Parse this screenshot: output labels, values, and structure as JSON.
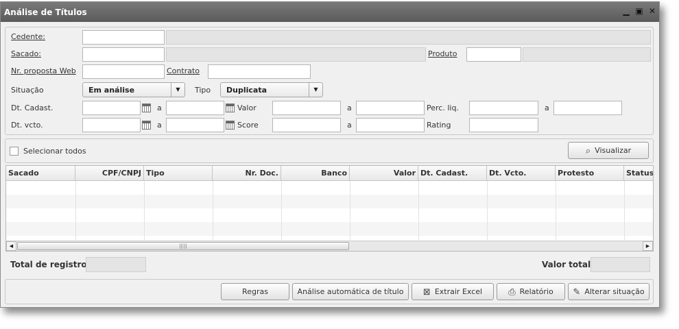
{
  "window": {
    "title": "Análise de Títulos"
  },
  "filters": {
    "cedente_label": "Cedente:",
    "sacado_label": "Sacado:",
    "produto_label": "Produto",
    "proposta_label": "Nr. proposta Web",
    "contrato_label": "Contrato",
    "situacao_label": "Situação",
    "situacao_value": "Em análise",
    "tipo_label": "Tipo",
    "tipo_value": "Duplicata",
    "dt_cadast_label": "Dt. Cadast.",
    "dt_vcto_label": "Dt. vcto.",
    "a_label": "a",
    "valor_label": "Valor",
    "score_label": "Score",
    "perc_label": "Perc. liq.",
    "rating_label": "Rating"
  },
  "toolbar": {
    "select_all_label": "Selecionar todos",
    "visualizar_label": "Visualizar"
  },
  "table": {
    "columns": [
      "Sacado",
      "CPF/CNPJ",
      "Tipo",
      "Nr. Doc.",
      "Banco",
      "Valor",
      "Dt. Cadast.",
      "Dt. Vcto.",
      "Protesto",
      "Status"
    ]
  },
  "footer": {
    "total_registros_label": "Total de registros:",
    "valor_total_label": "Valor total:"
  },
  "actions": {
    "regras": "Regras",
    "analise": "Análise automática de título",
    "excel": "Extrair Excel",
    "relatorio": "Relatório",
    "alterar": "Alterar situação"
  },
  "icons": {
    "calendar": "calendar-icon",
    "search": "search-icon",
    "excel": "excel-icon",
    "printer": "printer-icon",
    "edit": "edit-icon"
  }
}
